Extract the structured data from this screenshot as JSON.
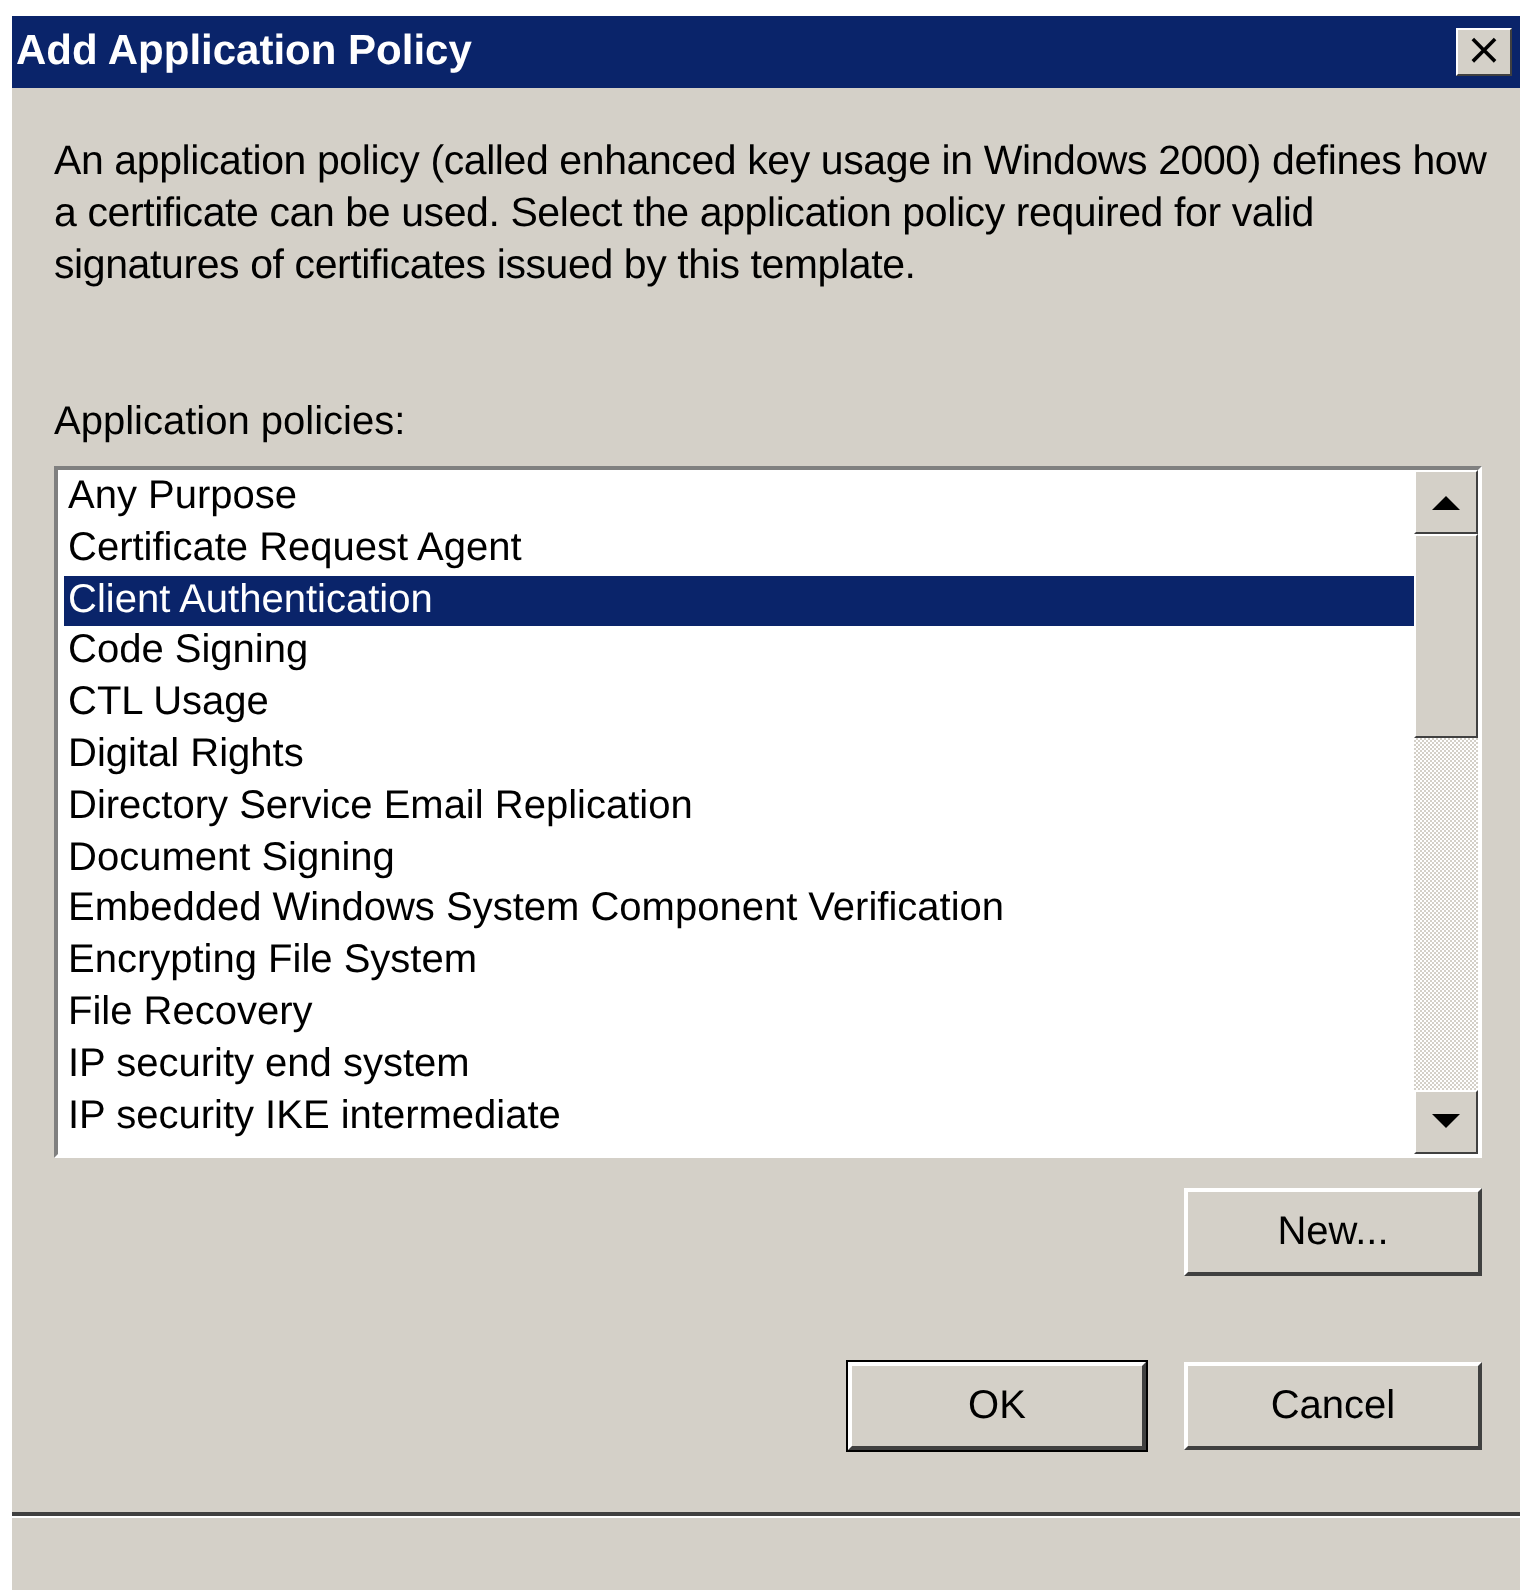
{
  "window": {
    "title": "Add Application Policy",
    "close": "×"
  },
  "description": "An application policy (called enhanced key usage in Windows 2000) defines how a certificate can be used. Select the application policy required for valid signatures of certificates issued by this template.",
  "list_label": "Application policies:",
  "policies": [
    {
      "label": "Any Purpose",
      "selected": false
    },
    {
      "label": "Certificate Request Agent",
      "selected": false
    },
    {
      "label": "Client Authentication",
      "selected": true
    },
    {
      "label": "Code Signing",
      "selected": false
    },
    {
      "label": "CTL Usage",
      "selected": false
    },
    {
      "label": "Digital Rights",
      "selected": false
    },
    {
      "label": "Directory Service Email Replication",
      "selected": false
    },
    {
      "label": "Document Signing",
      "selected": false
    },
    {
      "label": "Embedded Windows System Component Verification",
      "selected": false
    },
    {
      "label": "Encrypting File System",
      "selected": false
    },
    {
      "label": "File Recovery",
      "selected": false
    },
    {
      "label": "IP security end system",
      "selected": false
    },
    {
      "label": "IP security IKE intermediate",
      "selected": false
    }
  ],
  "new_button": "New...",
  "buttons": [
    {
      "label": "OK",
      "default": true
    },
    {
      "label": "Cancel",
      "default": false
    }
  ]
}
